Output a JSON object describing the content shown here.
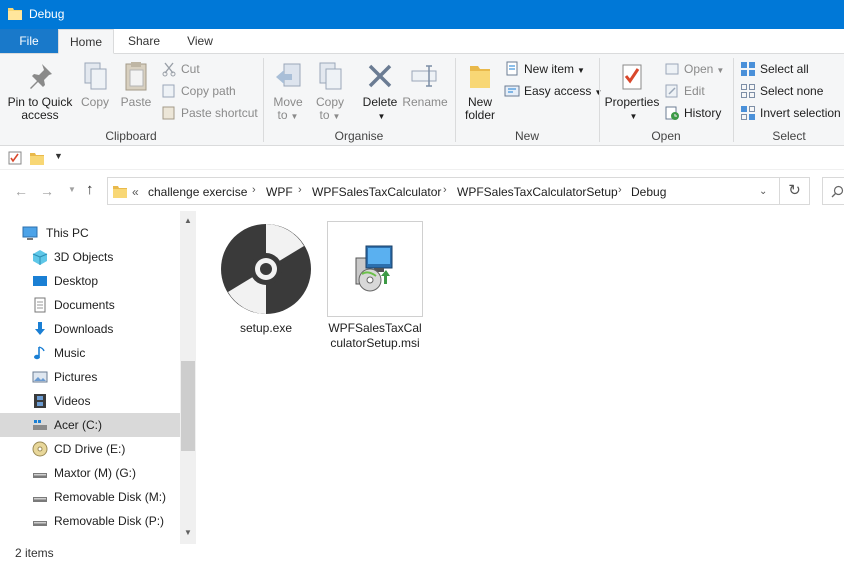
{
  "window": {
    "title": "Debug",
    "status": "2 items"
  },
  "tabs": {
    "file": "File",
    "home": "Home",
    "share": "Share",
    "view": "View"
  },
  "ribbon": {
    "clipboard": {
      "label": "Clipboard",
      "pin_line1": "Pin to Quick",
      "pin_line2": "access",
      "copy": "Copy",
      "paste": "Paste",
      "cut": "Cut",
      "copy_path": "Copy path",
      "paste_shortcut": "Paste shortcut"
    },
    "organise": {
      "label": "Organise",
      "move_to": "Move",
      "move_to2": "to",
      "copy_to": "Copy",
      "copy_to2": "to",
      "delete": "Delete",
      "rename": "Rename"
    },
    "new": {
      "label": "New",
      "new_folder1": "New",
      "new_folder2": "folder",
      "new_item": "New item",
      "easy_access": "Easy access"
    },
    "open": {
      "label": "Open",
      "properties": "Properties",
      "open": "Open",
      "edit": "Edit",
      "history": "History"
    },
    "select": {
      "label": "Select",
      "select_all": "Select all",
      "select_none": "Select none",
      "invert": "Invert selection"
    }
  },
  "address": {
    "overflow": "«",
    "crumbs": [
      "challenge exercise",
      "WPF",
      "WPFSalesTaxCalculator",
      "WPFSalesTaxCalculatorSetup",
      "Debug"
    ]
  },
  "nav": {
    "items": [
      {
        "label": "This PC",
        "icon": "monitor-icon"
      },
      {
        "label": "3D Objects",
        "icon": "cube-icon"
      },
      {
        "label": "Desktop",
        "icon": "desktop-icon"
      },
      {
        "label": "Documents",
        "icon": "document-icon"
      },
      {
        "label": "Downloads",
        "icon": "download-icon"
      },
      {
        "label": "Music",
        "icon": "music-icon"
      },
      {
        "label": "Pictures",
        "icon": "picture-icon"
      },
      {
        "label": "Videos",
        "icon": "film-icon"
      },
      {
        "label": "Acer (C:)",
        "icon": "drive-icon"
      },
      {
        "label": "CD Drive (E:)",
        "icon": "cd-icon"
      },
      {
        "label": "Maxtor (M) (G:)",
        "icon": "drive-icon"
      },
      {
        "label": "Removable Disk (M:)",
        "icon": "drive-icon"
      },
      {
        "label": "Removable Disk (P:)",
        "icon": "drive-icon"
      }
    ]
  },
  "files": [
    {
      "name": "setup.exe",
      "icon": "disc-icon"
    },
    {
      "name": "WPFSalesTaxCalculatorSetup.msi",
      "icon": "installer-icon"
    }
  ],
  "colors": {
    "accent": "#0078d7",
    "file_tab": "#1979ca",
    "selected_nav": "#d9d9d9"
  }
}
